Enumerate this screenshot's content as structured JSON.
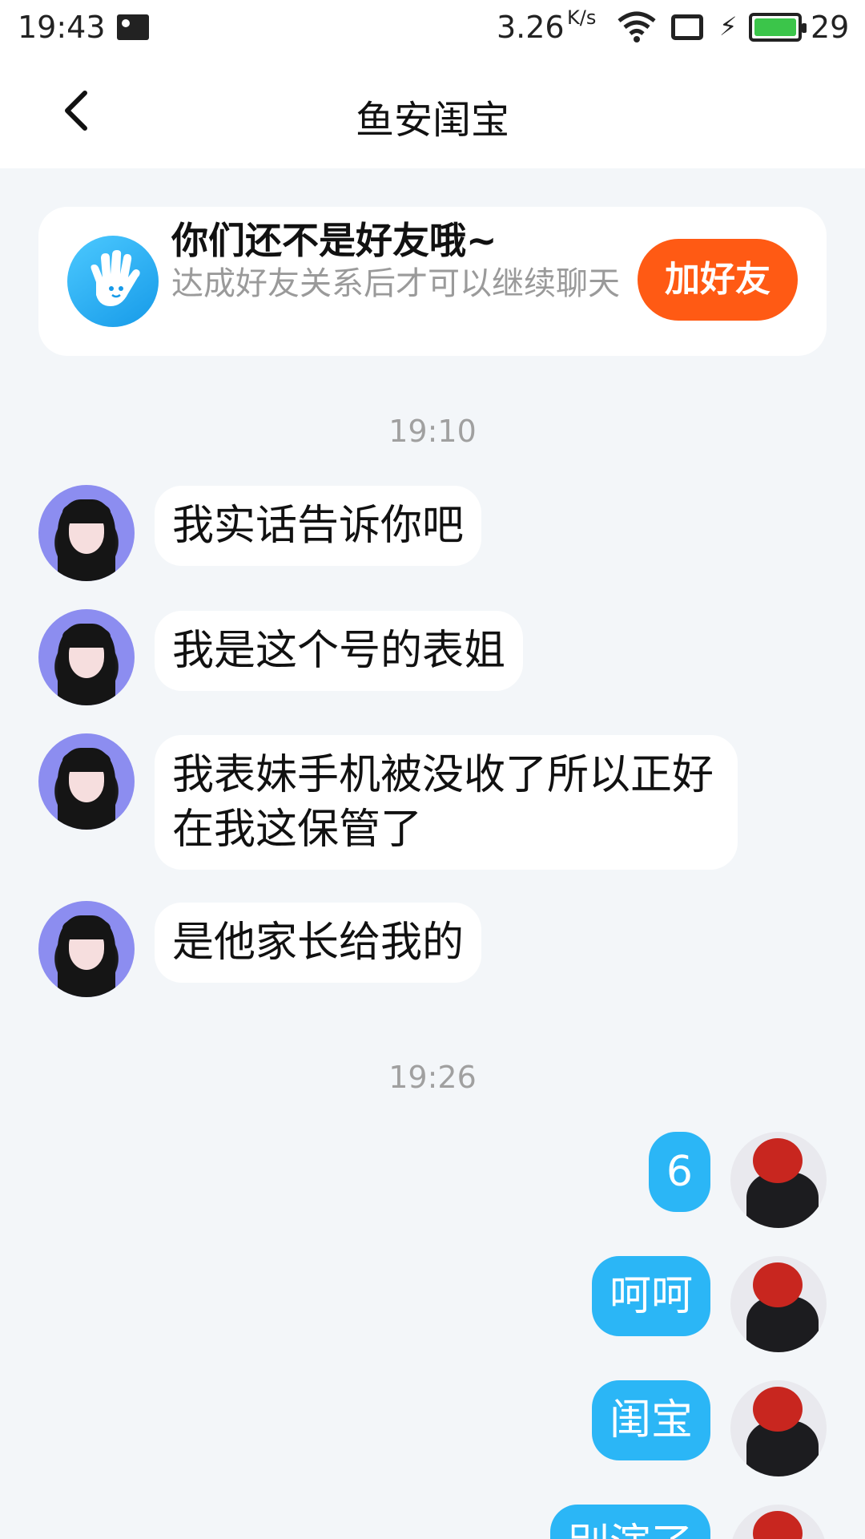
{
  "status_bar": {
    "time": "19:43",
    "speed": "3.26",
    "speed_unit": "K/s",
    "battery": "29"
  },
  "header": {
    "title": "鱼安闺宝"
  },
  "banner": {
    "title": "你们还不是好友哦~",
    "subtitle": "达成好友关系后才可以继续聊天",
    "button": "加好友"
  },
  "messages": {
    "ts1": "19:10",
    "in1": "我实话告诉你吧",
    "in2": "我是这个号的表姐",
    "in3": "我表妹手机被没收了所以正好在我这保管了",
    "in4": "是他家长给我的",
    "ts2": "19:26",
    "out1": "6",
    "out2": "呵呵",
    "out3": "闺宝",
    "out4": "别演了"
  }
}
